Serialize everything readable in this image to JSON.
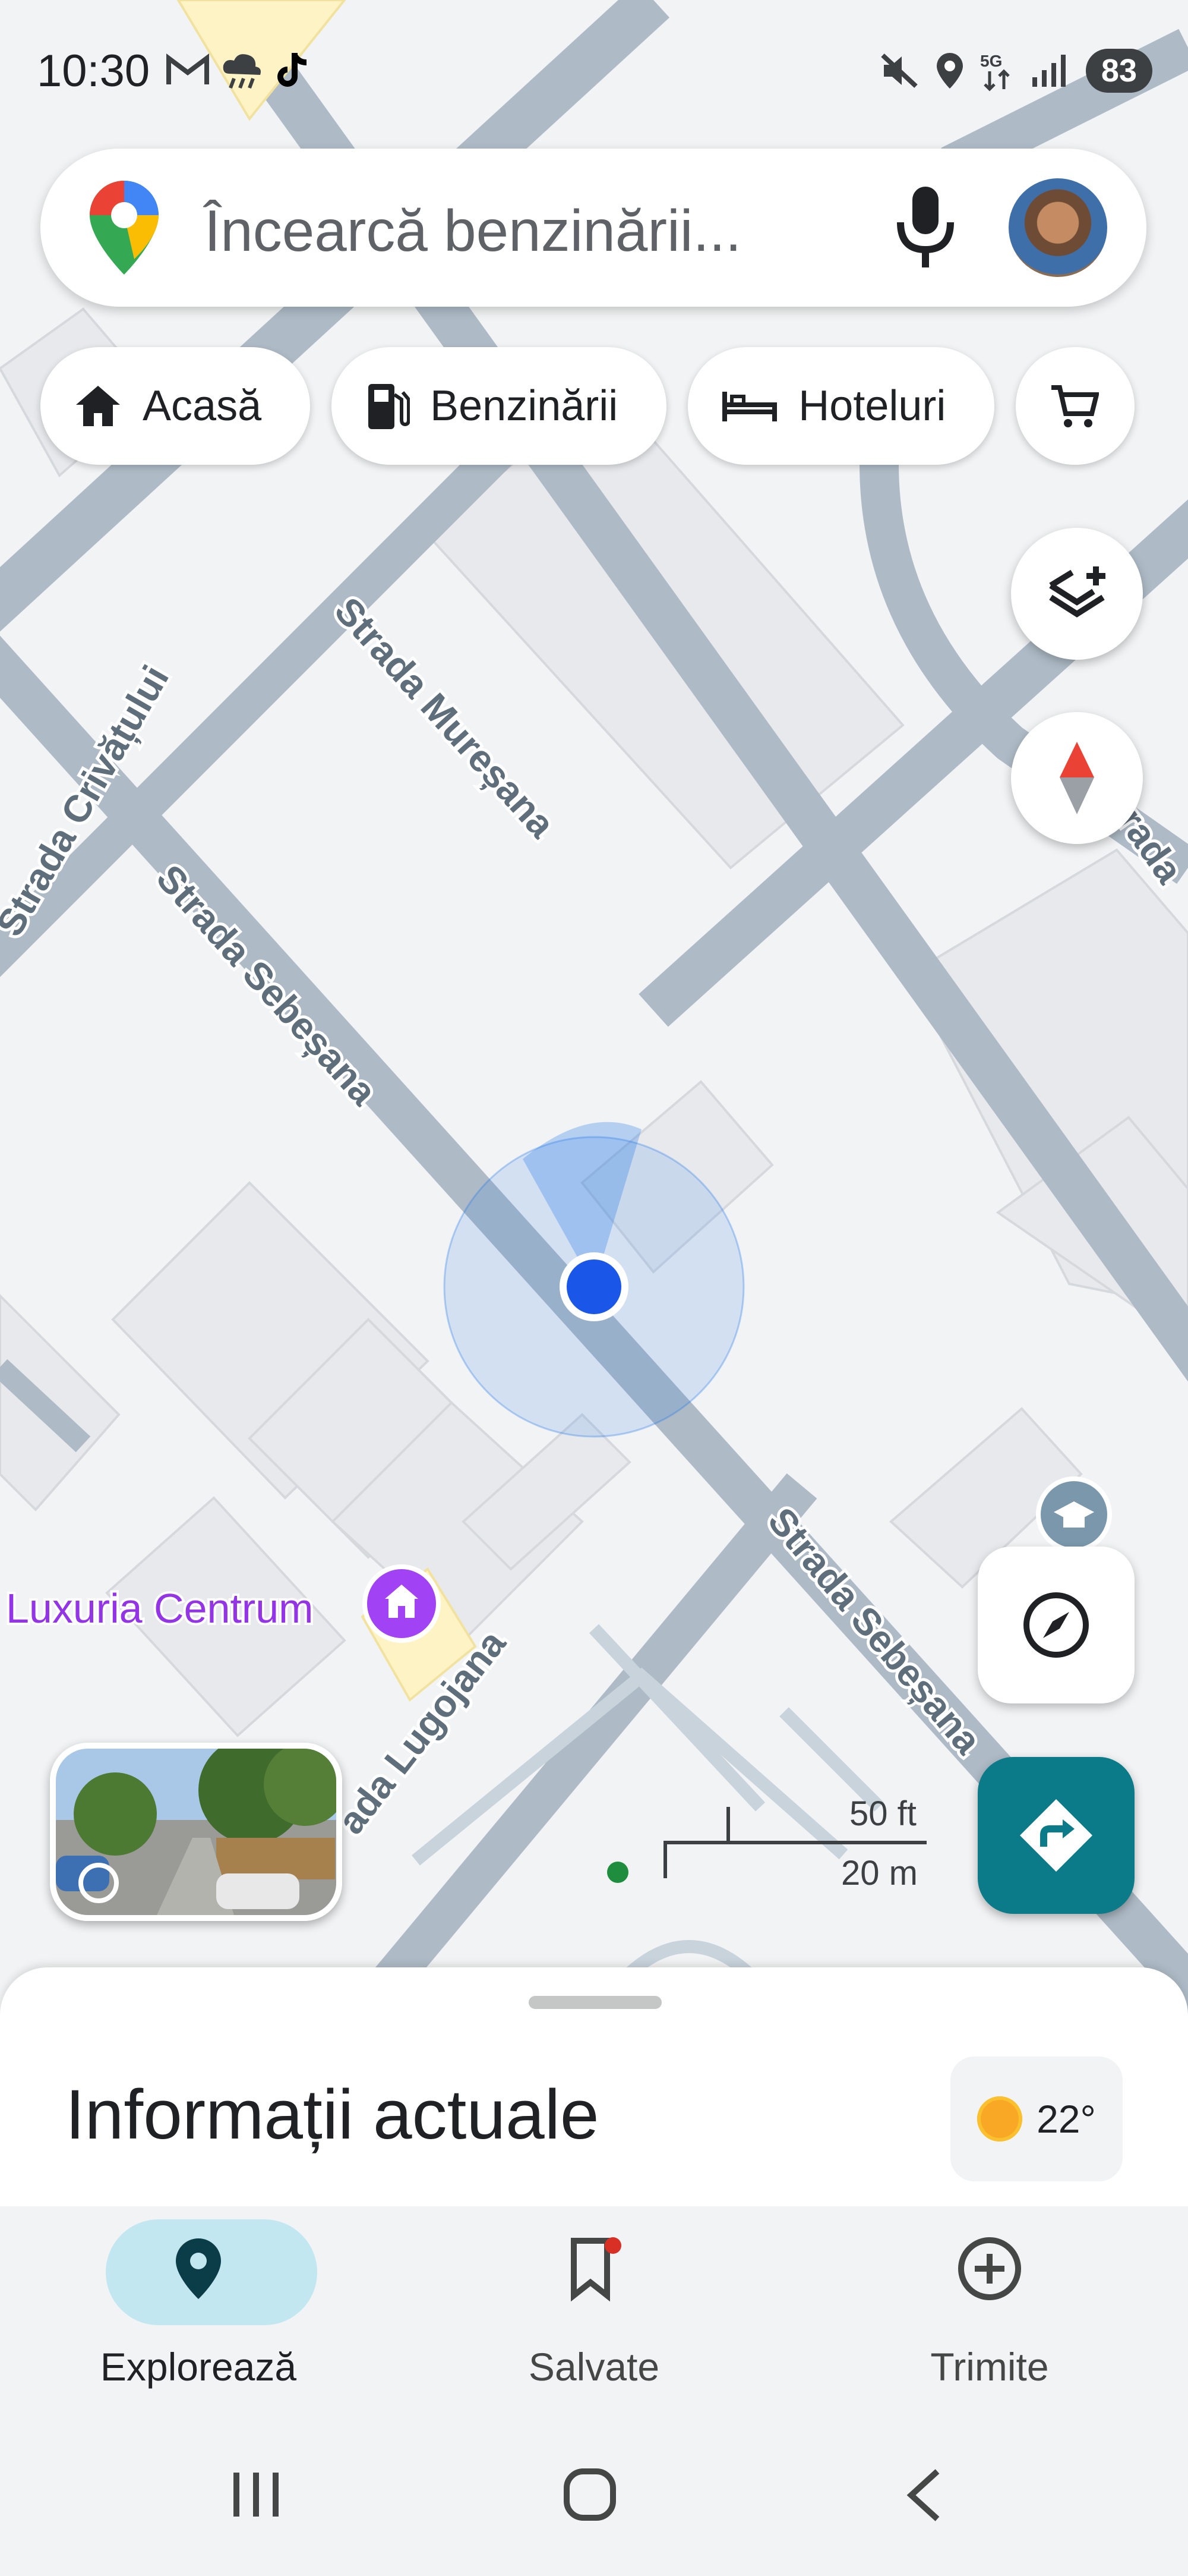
{
  "status_bar": {
    "time": "10:30",
    "left_icons": [
      "gmail-icon",
      "weather-icon",
      "tiktok-icon"
    ],
    "right_icons": [
      "mute-icon",
      "location-icon",
      "5g-icon",
      "signal-icon"
    ],
    "battery": "83"
  },
  "search": {
    "placeholder": "Încearcă benzinării...",
    "icons": [
      "maps-pin-icon",
      "mic-icon",
      "avatar"
    ]
  },
  "chips": [
    {
      "label": "Acasă",
      "icon": "home-icon"
    },
    {
      "label": "Benzinării",
      "icon": "gas-station-icon"
    },
    {
      "label": "Hoteluri",
      "icon": "bed-icon"
    },
    {
      "label": "",
      "icon": "cart-icon"
    }
  ],
  "map": {
    "streets": [
      "Strada Mureșana",
      "Strada Crivățului",
      "Strada Sebeșana",
      "Strada Sebeșana",
      "ada Lugojana",
      "rada"
    ],
    "place_label": "Luxuria Centrum",
    "scale": {
      "imperial": "50 ft",
      "metric": "20 m"
    }
  },
  "bottom_sheet": {
    "title": "Informații actuale",
    "temperature": "22°"
  },
  "bottom_nav": [
    {
      "label": "Explorează",
      "icon": "location-pin-icon",
      "active": true
    },
    {
      "label": "Salvate",
      "icon": "bookmark-icon",
      "active": false
    },
    {
      "label": "Trimite",
      "icon": "add-circle-icon",
      "active": false
    }
  ],
  "colors": {
    "accent": "#0b7b8a",
    "location_dot": "#1a57e8",
    "road": "#aebbc6",
    "place_purple": "#a142f4"
  }
}
